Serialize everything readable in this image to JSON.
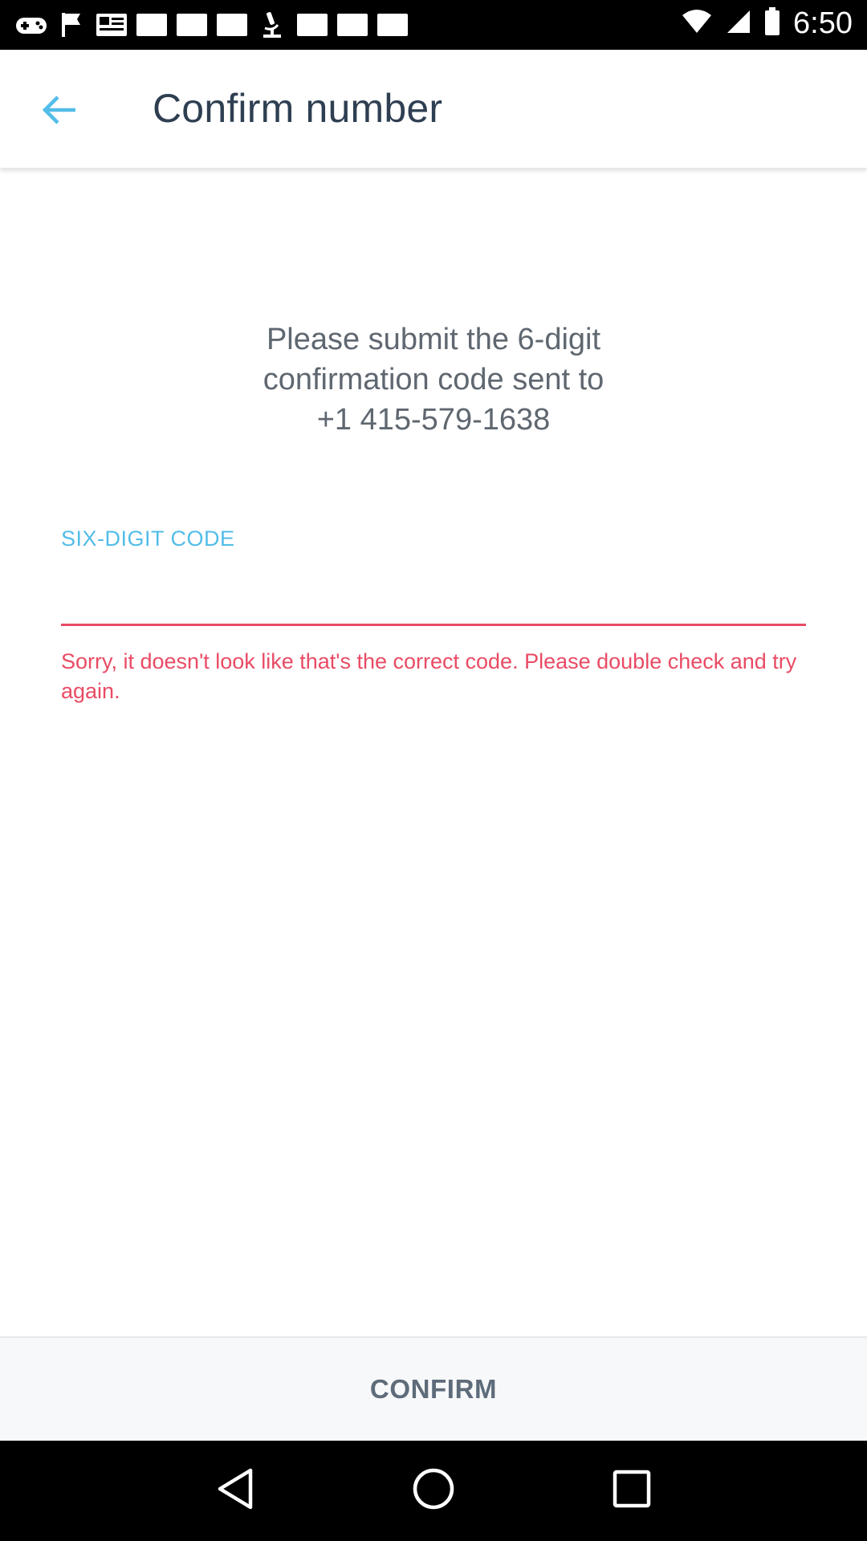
{
  "status_bar": {
    "time": "6:50",
    "left_icons": [
      "gamepad-icon",
      "flag-icon",
      "newspaper-icon",
      "square-icon",
      "square-icon",
      "square-icon",
      "microscope-icon",
      "square-icon",
      "square-icon",
      "square-icon"
    ],
    "right_icons": [
      "wifi-icon",
      "signal-icon",
      "battery-icon"
    ]
  },
  "app_bar": {
    "title": "Confirm number",
    "back_icon": "arrow-left-icon",
    "accent_color": "#52bde8"
  },
  "main": {
    "instructions": [
      "Please submit the 6-digit",
      "confirmation code sent to",
      "+1 415-579-1638"
    ],
    "code_field": {
      "label": "SIX-DIGIT CODE",
      "value": "",
      "placeholder": ""
    },
    "error_message": "Sorry, it doesn't look like that's the correct code. Please double check and try again.",
    "error_color": "#e94b64"
  },
  "footer": {
    "confirm_label": "CONFIRM"
  },
  "nav_bar": {
    "icons": [
      "back-triangle-icon",
      "home-circle-icon",
      "recents-square-icon"
    ]
  }
}
